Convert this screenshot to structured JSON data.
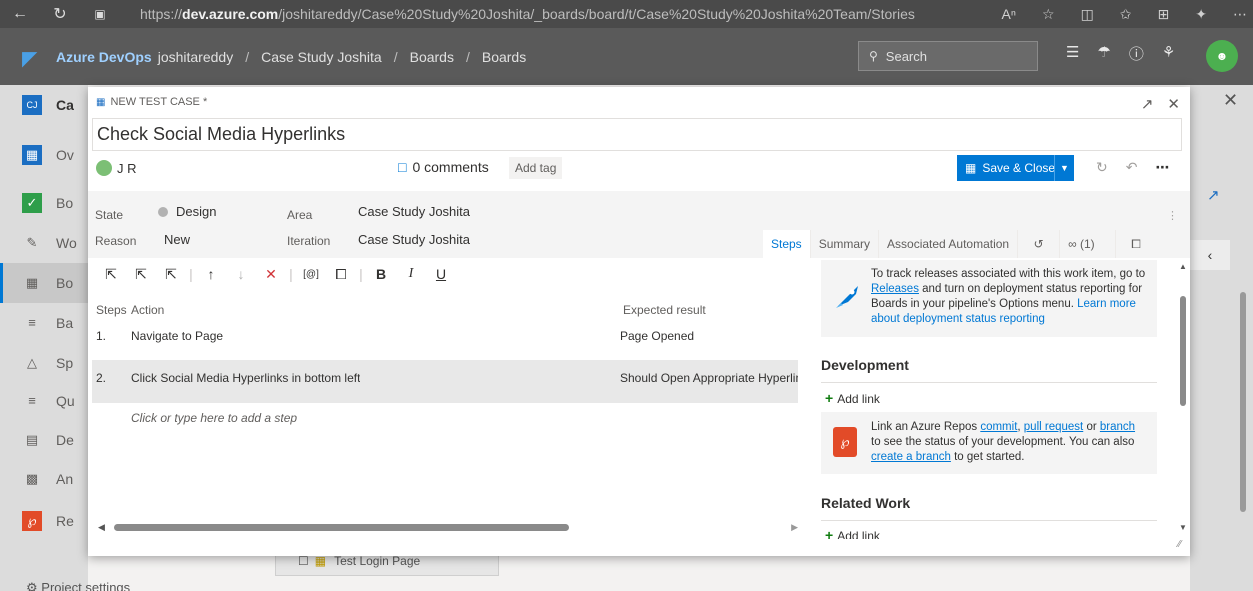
{
  "browser": {
    "url_prefix": "https://",
    "url_domain": "dev.azure.com",
    "url_path": "/joshitareddy/Case%20Study%20Joshita/_boards/board/t/Case%20Study%20Joshita%20Team/Stories",
    "icons": [
      "back-icon",
      "refresh-icon",
      "site-info-icon",
      "read-aloud-icon",
      "favorite-icon",
      "split-screen-icon",
      "favorites-icon",
      "collections-icon",
      "copilot-icon",
      "more-icon"
    ]
  },
  "header": {
    "brand": "Azure DevOps",
    "org": "joshitareddy",
    "project": "Case Study Joshita",
    "section": "Boards",
    "page": "Boards",
    "separator": "/",
    "search_placeholder": "Search"
  },
  "sidebar": {
    "items": [
      {
        "icon": "project-icon",
        "label": "Ca"
      },
      {
        "icon": "overview-icon",
        "label": "Ov"
      },
      {
        "icon": "boards-hub-icon",
        "label": "Bo"
      },
      {
        "icon": "work-items-icon",
        "label": "Wo"
      },
      {
        "icon": "boards-icon",
        "label": "Bo"
      },
      {
        "icon": "backlogs-icon",
        "label": "Ba"
      },
      {
        "icon": "sprints-icon",
        "label": "Sp"
      },
      {
        "icon": "queries-icon",
        "label": "Qu"
      },
      {
        "icon": "delivery-plans-icon",
        "label": "De"
      },
      {
        "icon": "analytics-icon",
        "label": "An"
      },
      {
        "icon": "repos-icon",
        "label": "Re"
      }
    ],
    "settings_label": "Project settings"
  },
  "backdrop": {
    "card_label": "Test Login Page"
  },
  "dialog": {
    "type_label": "NEW TEST CASE *",
    "title": "Check Social Media Hyperlinks",
    "assignee": "J R",
    "comments": "0 comments",
    "add_tag": "Add tag",
    "save_label": "Save & Close",
    "fields": {
      "state_label": "State",
      "state_value": "Design",
      "reason_label": "Reason",
      "reason_value": "New",
      "area_label": "Area",
      "area_value": "Case Study Joshita",
      "iteration_label": "Iteration",
      "iteration_value": "Case Study Joshita"
    },
    "tabs": [
      {
        "label": "Steps",
        "active": true
      },
      {
        "label": "Summary",
        "active": false
      },
      {
        "label": "Associated Automation",
        "active": false
      },
      {
        "label": "",
        "icon": "history-icon"
      },
      {
        "label": "(1)",
        "icon": "link-icon"
      },
      {
        "label": "",
        "icon": "attachment-icon"
      }
    ],
    "toolbar": {
      "bold": "B",
      "italic": "I",
      "underline": "U"
    },
    "grid": {
      "col_steps": "Steps",
      "col_action": "Action",
      "col_expected": "Expected result",
      "rows": [
        {
          "num": "1.",
          "action": "Navigate to Page",
          "expected": "Page Opened"
        },
        {
          "num": "2.",
          "action": "Click Social Media Hyperlinks in bottom left",
          "expected": "Should Open Appropriate Hyperlinks"
        }
      ],
      "add_step": "Click or type here to add a step"
    },
    "right_pane": {
      "deploy_line1": "To track releases associated with this work item, go to",
      "deploy_link1": "Releases",
      "deploy_line2": " and turn on deployment status reporting for",
      "deploy_line3": "Boards in your pipeline's Options menu. ",
      "deploy_link2": "Learn more",
      "deploy_link3": "about deployment status reporting",
      "development_heading": "Development",
      "add_link": "Add link",
      "dev_line1a": "Link an Azure Repos ",
      "dev_commit": "commit",
      "dev_comma": ", ",
      "dev_pr": "pull request",
      "dev_or": " or ",
      "dev_branch": "branch",
      "dev_line2": "to see the status of your development. You can also",
      "dev_create": "create a branch",
      "dev_line3": " to get started.",
      "related_heading": "Related Work",
      "add_link_related": "Add link"
    }
  }
}
